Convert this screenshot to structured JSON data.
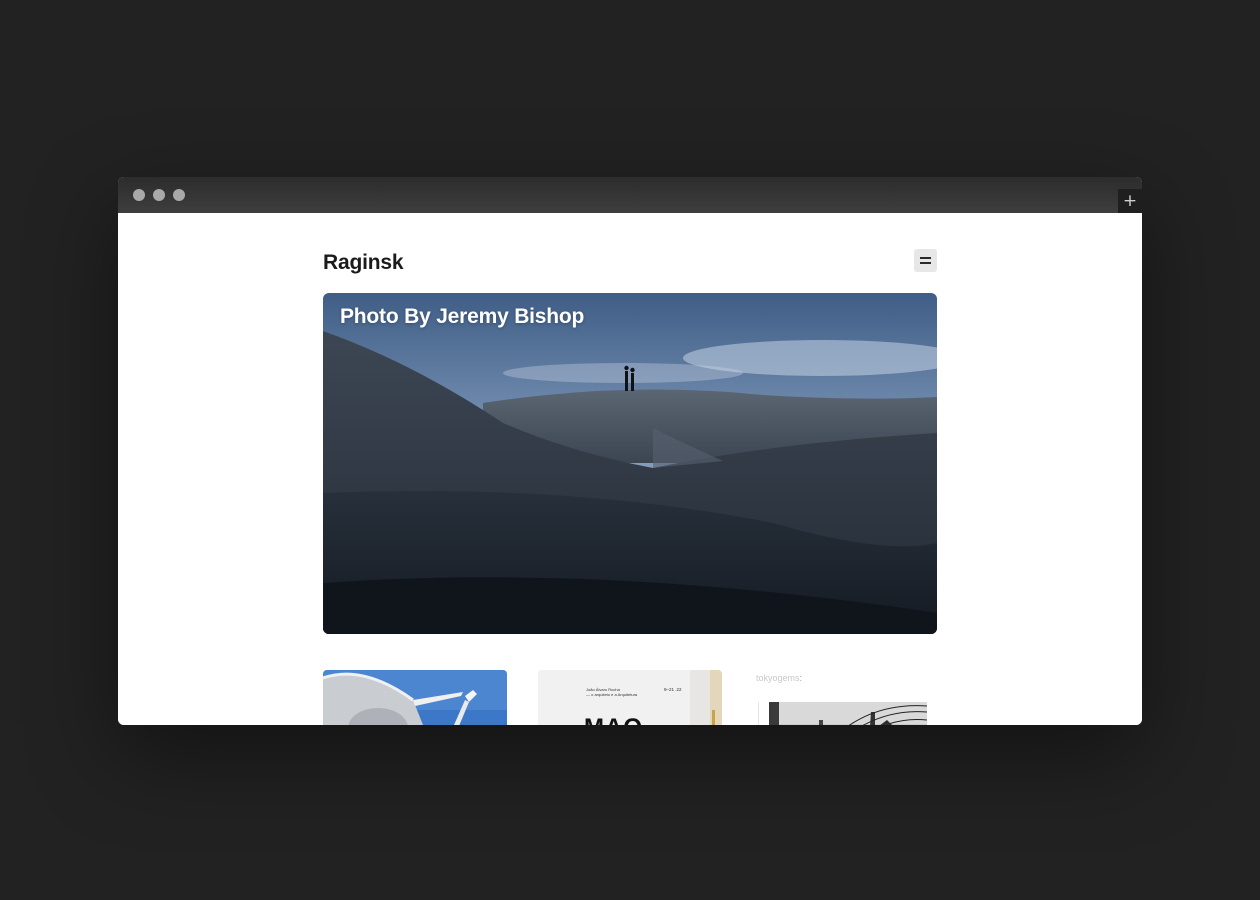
{
  "window": {
    "controls": [
      "close",
      "minimize",
      "maximize"
    ],
    "new_tab_icon": "plus-icon",
    "new_tab_label": "+"
  },
  "site": {
    "brand": "Raginsk",
    "menu_icon": "menu-icon"
  },
  "hero": {
    "caption": "Photo By Jeremy Bishop"
  },
  "thumbnails": [
    {
      "subject": "radio telescope dish under blue sky"
    },
    {
      "subject": "exhibition poster",
      "title_line1": "João Álvaro Rocha",
      "title_line2": "— o arquiteto e a Arquitetura",
      "date": "9–21 .22",
      "big_text": "MAO"
    }
  ],
  "embed": {
    "username": "tokyogems",
    "separator": ":",
    "subject": "street scene with power lines"
  }
}
